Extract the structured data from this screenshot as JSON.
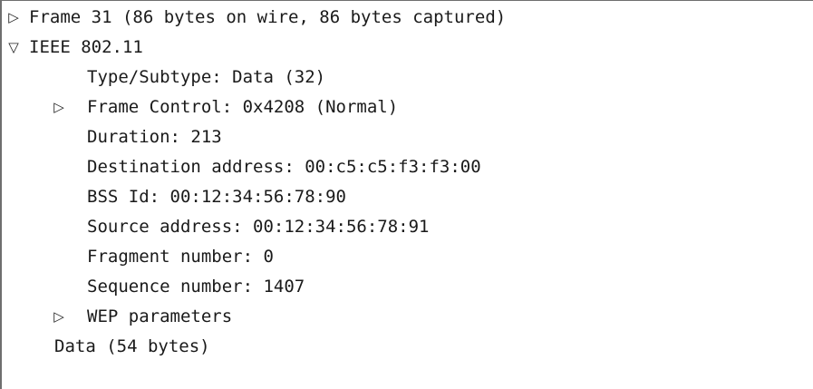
{
  "tree": {
    "frame": {
      "label": "Frame 31 (86 bytes on wire, 86 bytes captured)",
      "expanded": false
    },
    "ieee": {
      "label": "IEEE 802.11",
      "expanded": true
    },
    "type_subtype": {
      "label": "Type/Subtype: Data (32)"
    },
    "frame_control": {
      "label": "Frame Control: 0x4208 (Normal)",
      "expanded": false
    },
    "duration": {
      "label": "Duration: 213"
    },
    "destination": {
      "label": "Destination address: 00:c5:c5:f3:f3:00"
    },
    "bss_id": {
      "label": "BSS Id: 00:12:34:56:78:90"
    },
    "source": {
      "label": "Source address: 00:12:34:56:78:91"
    },
    "fragment": {
      "label": "Fragment number: 0"
    },
    "sequence": {
      "label": "Sequence number: 1407"
    },
    "wep": {
      "label": "WEP parameters",
      "expanded": false
    },
    "data": {
      "label": "Data (54 bytes)"
    }
  },
  "icons": {
    "collapsed": "▷",
    "expanded": "▽"
  }
}
